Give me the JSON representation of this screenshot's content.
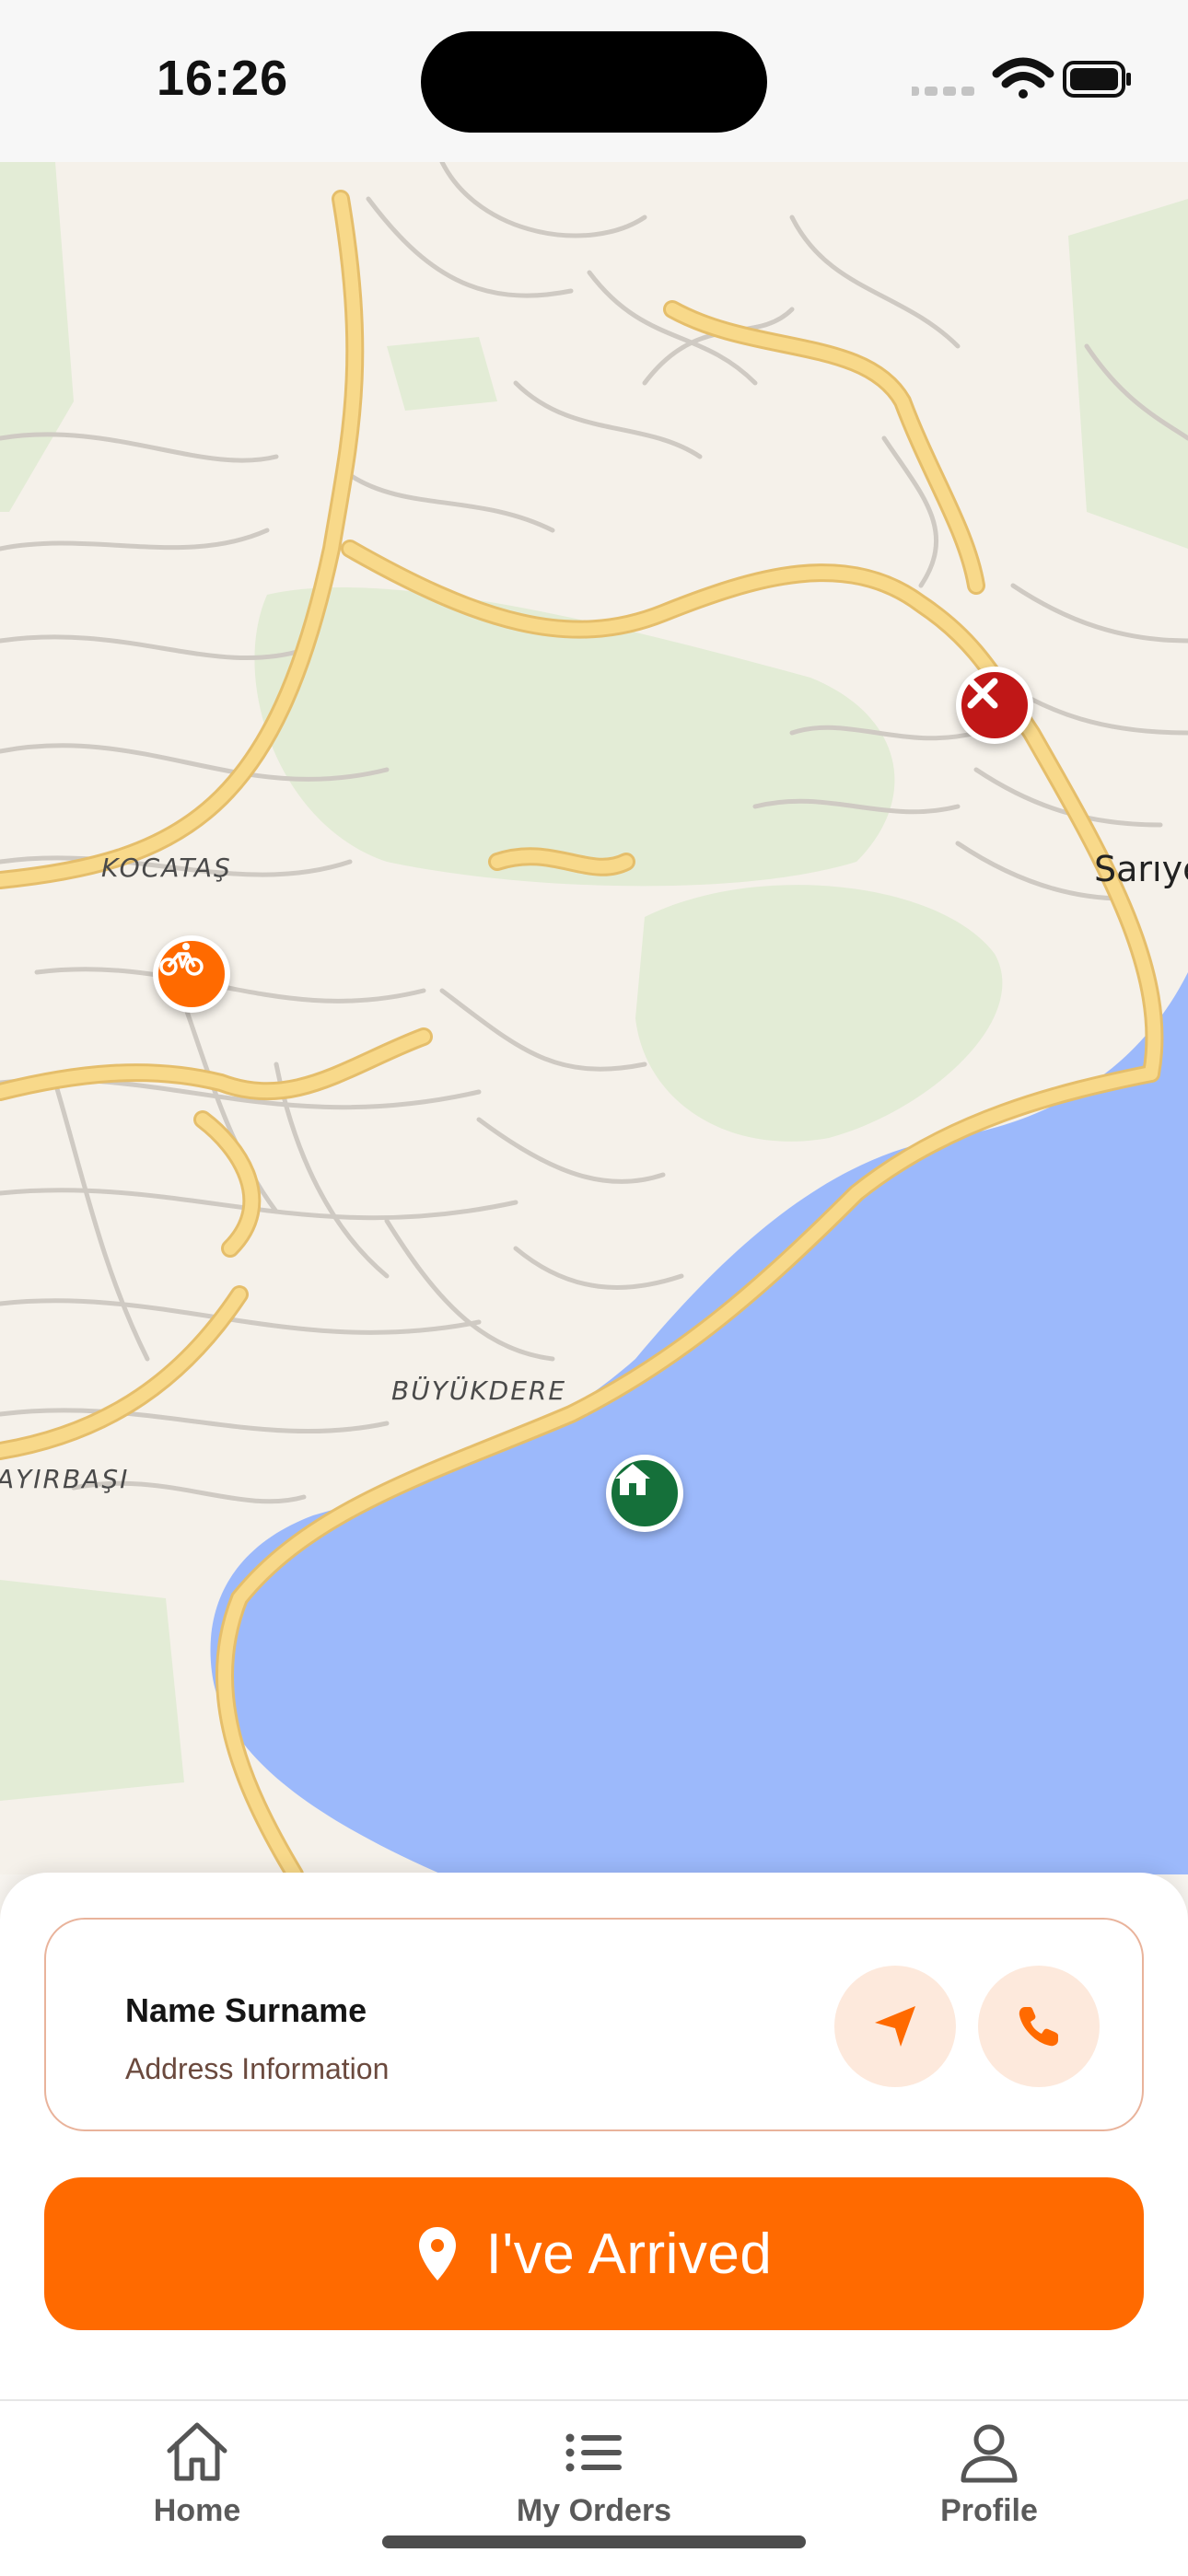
{
  "status_bar": {
    "time": "16:26"
  },
  "map": {
    "labels": {
      "kocatas": "KOCATAŞ",
      "sariyer": "Sarıye",
      "buyukdere": "BÜYÜKDERE",
      "ayirbasi": "AYIRBAŞI"
    },
    "pins": [
      {
        "name": "restaurant-pin",
        "icon": "fork-knife-icon",
        "color": "#c01717"
      },
      {
        "name": "courier-pin",
        "icon": "bicycle-icon",
        "color": "#ff6a00"
      },
      {
        "name": "home-pin",
        "icon": "house-icon",
        "color": "#15703a"
      }
    ],
    "colors": {
      "water": "#9cb9fb",
      "park": "#e3ecd6",
      "major_road": "#f8d98a",
      "street": "#cfcac3"
    }
  },
  "customer": {
    "name": "Name Surname",
    "address": "Address Information",
    "actions": [
      "navigate-icon",
      "phone-icon"
    ]
  },
  "primary_action": {
    "label": "I've Arrived",
    "icon": "location-pin-icon",
    "color": "#ff6a00"
  },
  "tabbar": {
    "items": [
      {
        "label": "Home",
        "icon": "house-icon"
      },
      {
        "label": "My Orders",
        "icon": "list-icon"
      },
      {
        "label": "Profile",
        "icon": "person-icon"
      }
    ]
  }
}
